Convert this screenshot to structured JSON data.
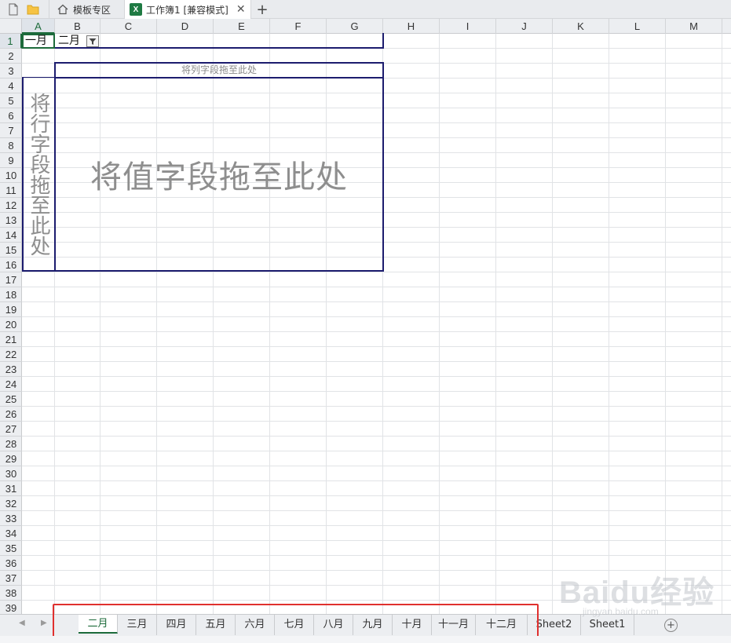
{
  "titlebar": {
    "home_tab_label": "模板专区",
    "workbook_tab_label": "工作簿1 [兼容模式]",
    "close_glyph": "✕",
    "add_glyph": "+"
  },
  "columns": [
    "A",
    "B",
    "C",
    "D",
    "E",
    "F",
    "G",
    "H",
    "I",
    "J",
    "K",
    "L",
    "M"
  ],
  "selected_column": "A",
  "rows": [
    "1",
    "2",
    "3",
    "4",
    "5",
    "6",
    "7",
    "8",
    "9",
    "10",
    "11",
    "12",
    "13",
    "14",
    "15",
    "16",
    "17",
    "18",
    "19",
    "20",
    "21",
    "22",
    "23",
    "24",
    "25",
    "26",
    "27",
    "28",
    "29",
    "30",
    "31",
    "32",
    "33",
    "34",
    "35",
    "36",
    "37",
    "38",
    "39"
  ],
  "selected_row": "1",
  "cells": {
    "A1": "一月",
    "B1": "二月"
  },
  "pivot": {
    "column_area_hint": "将列字段拖至此处",
    "value_area_hint": "将值字段拖至此处",
    "row_area_hint": "将行字段拖至此处"
  },
  "sheet_tabs": [
    "二月",
    "三月",
    "四月",
    "五月",
    "六月",
    "七月",
    "八月",
    "九月",
    "十月",
    "十一月",
    "十二月",
    "Sheet2",
    "Sheet1"
  ],
  "active_sheet": "二月",
  "watermark": {
    "main": "Baidu经验",
    "sub": "jingyan.baidu.com"
  },
  "colors": {
    "accent": "#1d6b3b",
    "pivot_border": "#1c1c6e",
    "highlight_box": "#e0302e"
  },
  "icons": [
    "new-file-icon",
    "folder-icon",
    "home-icon",
    "excel-icon",
    "filter-dropdown-icon",
    "add-sheet-icon"
  ]
}
